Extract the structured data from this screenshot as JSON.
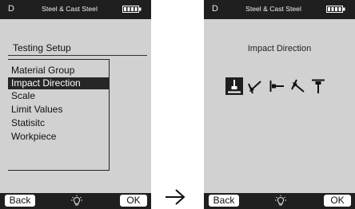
{
  "left_screen": {
    "header": {
      "mode": "D",
      "title": "Steel & Cast Steel",
      "battery_icon": "battery-full-icon"
    },
    "section_title": "Testing Setup",
    "menu": [
      {
        "label": "Material Group",
        "selected": false
      },
      {
        "label": "Impact Direction",
        "selected": true
      },
      {
        "label": "Scale",
        "selected": false
      },
      {
        "label": "Limit Values",
        "selected": false
      },
      {
        "label": "Statisitc",
        "selected": false
      },
      {
        "label": "Workpiece",
        "selected": false
      }
    ],
    "footer": {
      "back_label": "Back",
      "ok_label": "OK",
      "center_icon": "light-bulb-icon"
    }
  },
  "right_screen": {
    "header": {
      "mode": "D",
      "title": "Steel & Cast Steel",
      "battery_icon": "battery-full-icon"
    },
    "title": "Impact Direction",
    "directions": [
      {
        "icon": "impact-down-icon",
        "selected": true
      },
      {
        "icon": "impact-down-left-icon",
        "selected": false
      },
      {
        "icon": "impact-horizontal-icon",
        "selected": false
      },
      {
        "icon": "impact-up-left-icon",
        "selected": false
      },
      {
        "icon": "impact-up-icon",
        "selected": false
      }
    ],
    "footer": {
      "back_label": "Back",
      "ok_label": "OK",
      "center_icon": "light-bulb-icon"
    }
  },
  "transition_icon": "right-arrow-icon",
  "colors": {
    "screen_bg": "#d1d1d1",
    "bar_bg": "#1f1f1f",
    "selection_bg": "#262626",
    "text": "#111111"
  }
}
